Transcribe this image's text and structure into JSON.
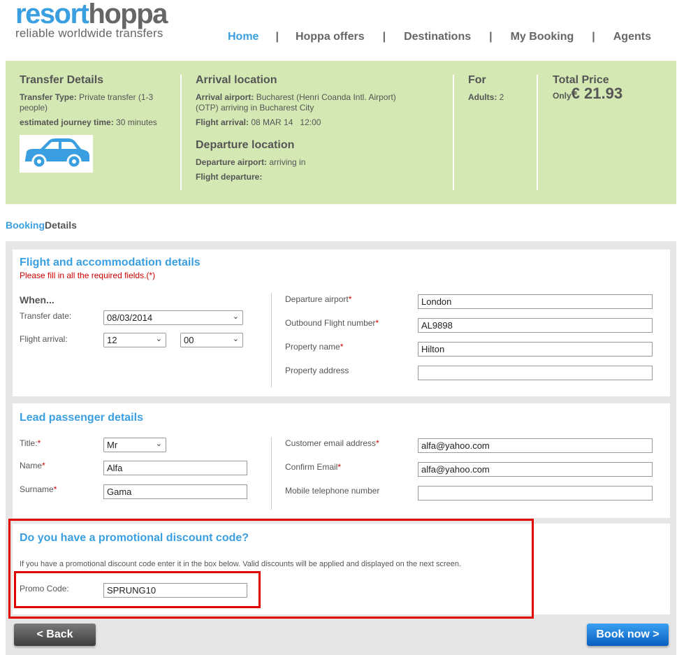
{
  "logo": {
    "part1": "resort",
    "part2": "hoppa",
    "tagline": "reliable worldwide transfers"
  },
  "nav": {
    "home": "Home",
    "offers": "Hoppa offers",
    "destinations": "Destinations",
    "booking": "My Booking",
    "agents": "Agents",
    "separator": "|"
  },
  "summary": {
    "transfer": {
      "title": "Transfer Details",
      "type_label": "Transfer Type:",
      "type_value": "Private transfer (1-3 people)",
      "time_label": "estimated journey time:",
      "time_value": "30 minutes"
    },
    "arrival": {
      "title": "Arrival location",
      "airport_label": "Arrival airport:",
      "airport_value": "Bucharest (Henri Coanda Intl. Airport) (OTP) arriving in Bucharest City",
      "flight_label": "Flight arrival:",
      "flight_value": "08 MAR 14   12:00"
    },
    "departure": {
      "title": "Departure location",
      "airport_label": "Departure airport:",
      "airport_value": "arriving in",
      "flight_label": "Flight departure:"
    },
    "for": {
      "title": "For",
      "adults_label": "Adults:",
      "adults_value": "2"
    },
    "price": {
      "title": "Total Price",
      "only": "Only",
      "value": "€ 21.93"
    }
  },
  "breadcrumb": {
    "part1": "Booking",
    "part2": "Details"
  },
  "flight_panel": {
    "title": "Flight and accommodation details",
    "required_note": "Please fill in all the required fields.(*)",
    "when": "When...",
    "transfer_date_label": "Transfer date:",
    "transfer_date_value": "08/03/2014",
    "flight_arrival_label": "Flight arrival:",
    "hour_value": "12",
    "minute_value": "00",
    "departure_airport_label": "Departure airport",
    "departure_airport_value": "London",
    "outbound_label": "Outbound Flight number",
    "outbound_value": "AL9898",
    "property_name_label": "Property name",
    "property_name_value": "Hilton",
    "property_address_label": "Property address",
    "property_address_value": ""
  },
  "lead_panel": {
    "title": "Lead passenger details",
    "title_label": "Title:",
    "title_value": "Mr",
    "name_label": "Name",
    "name_value": "Alfa",
    "surname_label": "Surname",
    "surname_value": "Gama",
    "email_label": "Customer email address",
    "email_value": "alfa@yahoo.com",
    "confirm_label": "Confirm Email",
    "confirm_value": "alfa@yahoo.com",
    "mobile_label": "Mobile telephone number",
    "mobile_value": ""
  },
  "promo_panel": {
    "title": "Do you have a promotional discount code?",
    "text": "If you have a promotional discount code enter it in the box below. Valid discounts will be applied and displayed on the next screen.",
    "code_label": "Promo Code:",
    "code_value": "SPRUNG10"
  },
  "buttons": {
    "back": "< Back",
    "book": "Book now >"
  },
  "star": "*",
  "chevron": "⌄",
  "colors": {
    "accent": "#3a9fe0",
    "summary_bg": "#d4e8b4",
    "highlight": "#e00000"
  }
}
